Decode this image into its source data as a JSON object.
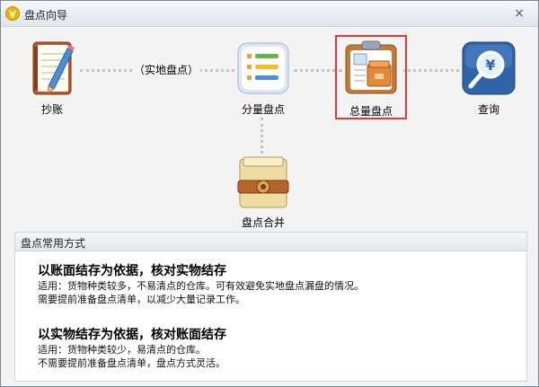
{
  "window": {
    "title": "盘点向导",
    "close_symbol": "×"
  },
  "workflow": {
    "nodes": [
      {
        "id": "copy-account",
        "label": "抄账",
        "icon": "notebook-pencil-icon"
      },
      {
        "id": "category-count",
        "label": "分量盘点",
        "icon": "checklist-clipboard-icon"
      },
      {
        "id": "total-count",
        "label": "总量盘点",
        "icon": "clipboard-boxes-icon",
        "selected": true
      },
      {
        "id": "query",
        "label": "查询",
        "icon": "yen-magnifier-icon"
      },
      {
        "id": "merge-count",
        "label": "盘点合并",
        "icon": "folder-binder-icon"
      }
    ],
    "connector_label": "（实地盘点）"
  },
  "methods": {
    "title": "盘点常用方式",
    "items": [
      {
        "title": "以账面结存为依据，核对实物结存",
        "lines": [
          "适用：货物种类较多，不易清点的仓库。可有效避免实地盘点漏盘的情况。",
          "需要提前准备盘点清单，以减少大量记录工作。"
        ]
      },
      {
        "title": "以实物结存为依据，核对账面结存",
        "lines": [
          "适用：货物种类较少，易清点的仓库。",
          "不需要提前准备盘点清单，盘点方式灵活。"
        ]
      }
    ]
  },
  "colors": {
    "selection_border": "#e53935",
    "dotted_connector": "#c4c4c4"
  }
}
